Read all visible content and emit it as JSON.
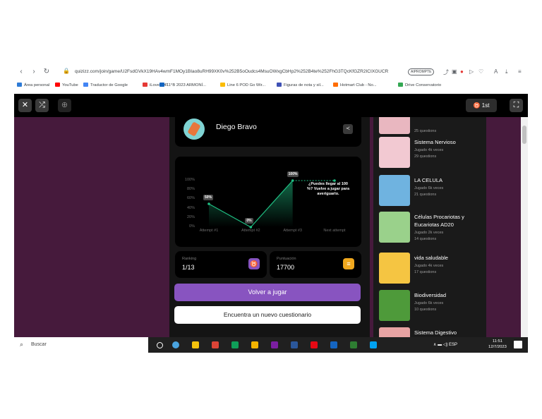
{
  "browser": {
    "url": "quizizz.com/join/game/U2FsdGVkX19HAv4wmF1MOy1BIao8uRH99XK0v%252B5oOudcs4MsuOWxgCbHp2%252B4te%252FhG3TQcKfGZR2ICIXGUCR",
    "ai_prompt_label": "AIPROMPTE",
    "bookmarks": [
      "Área personal",
      "YouTube",
      "Traductor de Google",
      "iLovePDF",
      "11°B 2023 ARMONÍ...",
      "Line 6 POD Go Wir...",
      "Figuras de nota y sil...",
      "Hotmart Club - No...",
      "Drive Conservatorio"
    ],
    "bookmark_colors": [
      "#2e7bd6",
      "#ff0000",
      "#4285f4",
      "#e53935",
      "#1565c0",
      "#fbbc05",
      "#3f51b5",
      "#ff6d00",
      "#34a853"
    ]
  },
  "app": {
    "rank_badge": "1st",
    "player_name": "Diego Bravo",
    "stats": {
      "ranking_label": "Ranking",
      "ranking_value": "1/13",
      "score_label": "Puntuación",
      "score_value": "17700"
    },
    "buttons": {
      "replay": "Volver a jugar",
      "new_quiz": "Encuentra un nuevo cuestionario"
    }
  },
  "chart_data": {
    "type": "line",
    "categories": [
      "Attempt #1",
      "Attempt #2",
      "Attempt #3",
      "Next attempt"
    ],
    "values": [
      50,
      0,
      100,
      100
    ],
    "data_labels": [
      "50%",
      "0%",
      "100%"
    ],
    "y_ticks": [
      "100%",
      "80%",
      "60%",
      "40%",
      "20%",
      "0%"
    ],
    "ylim": [
      0,
      100
    ],
    "annotation": "¿Puedes llegar al 100 %? Vuelve a jugar para averiguarlo."
  },
  "quizzes": [
    {
      "title": "",
      "plays": "",
      "questions": "25 questions",
      "color": "#e9b7c0"
    },
    {
      "title": "Sistema Nervioso",
      "plays": "Jugado 4k veces",
      "questions": "29 questions",
      "color": "#f2c9d2"
    },
    {
      "title": "LA CELULA",
      "plays": "Jugado 6k veces",
      "questions": "21 questions",
      "color": "#6fb3e0"
    },
    {
      "title": "Células Procariotas y Eucariotas AD20",
      "plays": "Jugado 2k veces",
      "questions": "14 questions",
      "color": "#9ad18b"
    },
    {
      "title": "vida saludable",
      "plays": "Jugado 4k veces",
      "questions": "17 questions",
      "color": "#f5c542"
    },
    {
      "title": "Biodiversidad",
      "plays": "Jugado 6k veces",
      "questions": "10 questions",
      "color": "#4e9a3a"
    },
    {
      "title": "Sistema Digestivo",
      "plays": "",
      "questions": "",
      "color": "#e7a3a3"
    }
  ],
  "taskbar": {
    "search_placeholder": "Buscar",
    "lang": "ESP",
    "time": "11:51",
    "date": "12/7/2023",
    "app_colors": [
      "#4aa3df",
      "#f4c20d",
      "#db4437",
      "#0f9d58",
      "#f4b400",
      "#7b1fa2",
      "#2b579a",
      "#e50914",
      "#1565c0",
      "#2e7d32",
      "#00a1f1"
    ]
  }
}
